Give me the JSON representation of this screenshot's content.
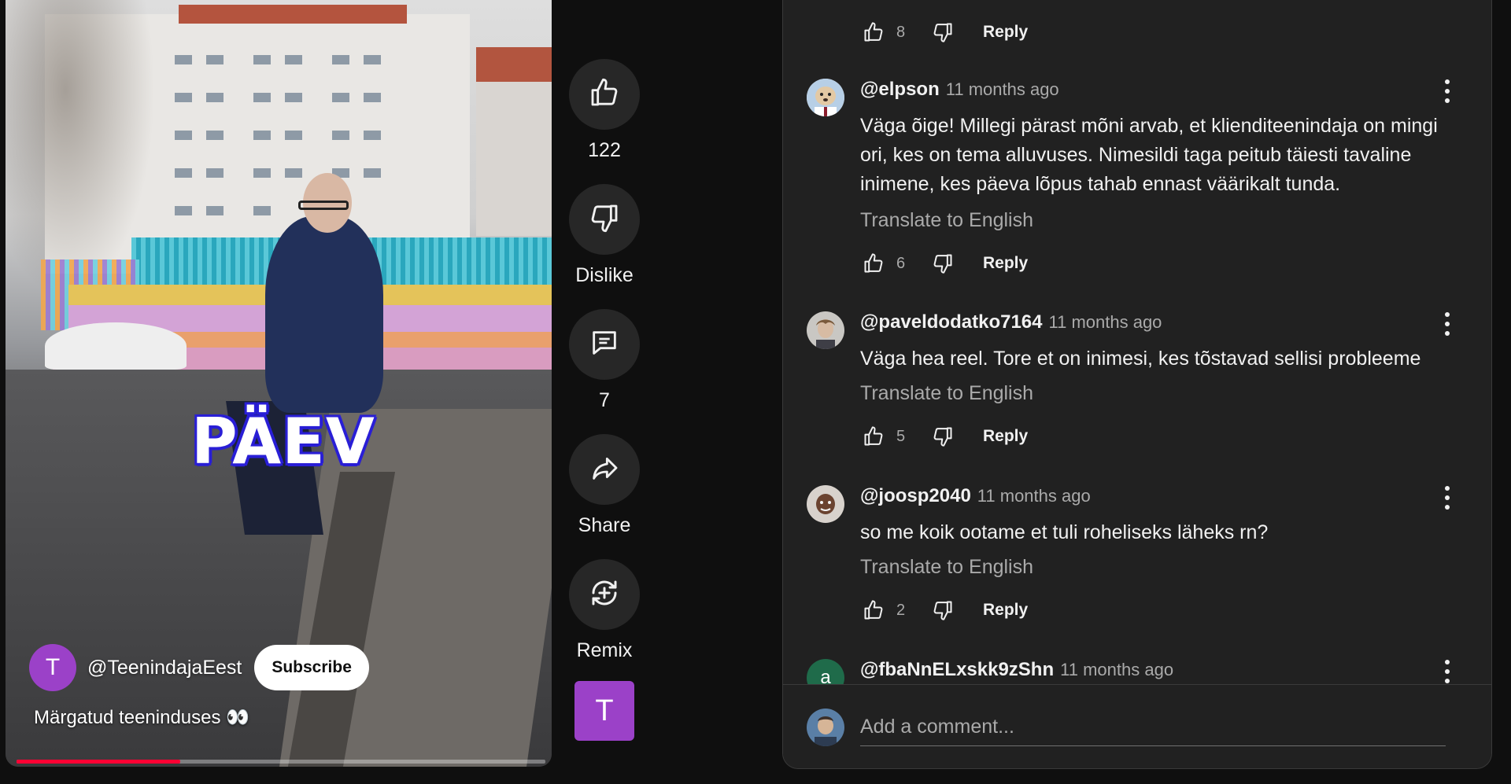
{
  "video": {
    "caption_word": "PÄEV",
    "channel_initial": "T",
    "channel_handle": "@TeenindajaEest",
    "subscribe_label": "Subscribe",
    "title": "Märgatud teeninduses 👀",
    "progress_fraction": 0.31,
    "progress_color": "#ff0033"
  },
  "actions": {
    "like_count": "122",
    "dislike_label": "Dislike",
    "comments_count": "7",
    "share_label": "Share",
    "remix_label": "Remix",
    "channel_initial": "T"
  },
  "comments_panel": {
    "top_actions": {
      "like_count": "8",
      "reply_label": "Reply"
    },
    "comments": [
      {
        "author": "@elpson",
        "time": "11 months ago",
        "text": "Väga õige! Millegi pärast mõni arvab, et klienditeenindaja on mingi ori, kes on tema alluvuses. Nimesildi taga peitub täiesti tavaline inimene, kes päeva lõpus tahab ennast väärikalt tunda.",
        "translate": "Translate to English",
        "likes": "6",
        "reply": "Reply"
      },
      {
        "author": "@paveldodatko7164",
        "time": "11 months ago",
        "text": "Väga hea reel. Tore et on inimesi, kes tõstavad sellisi probleeme",
        "translate": "Translate to English",
        "likes": "5",
        "reply": "Reply"
      },
      {
        "author": "@joosp2040",
        "time": "11 months ago",
        "text": "so me koik ootame et tuli roheliseks läheks rn?",
        "translate": "Translate to English",
        "likes": "2",
        "reply": "Reply"
      },
      {
        "author": "@fbaNnELxskk9zShn",
        "time": "11 months ago",
        "avatar_initial": "a"
      }
    ],
    "add_comment_placeholder": "Add a comment..."
  },
  "colors": {
    "background": "#0f0f0f",
    "panel": "#212121",
    "channel_purple": "#9b41c8",
    "caption_outline": "#2a1fd6"
  }
}
